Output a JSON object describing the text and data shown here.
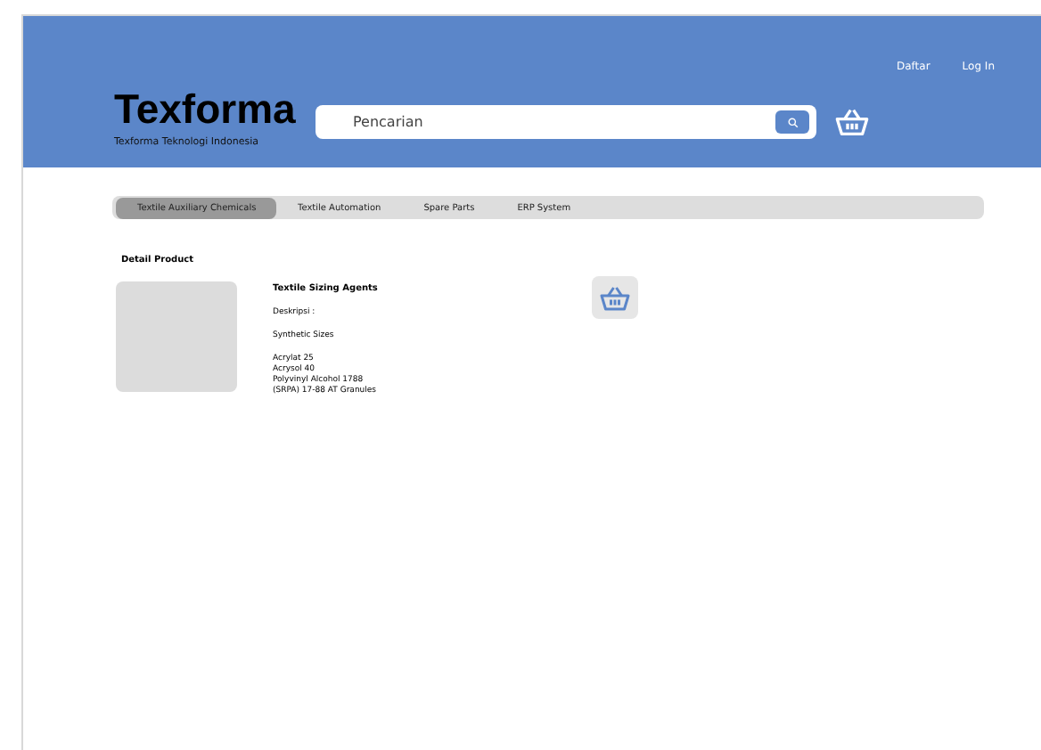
{
  "header": {
    "brand": "Texforma",
    "tagline": "Texforma Teknologi Indonesia",
    "nav_links": [
      "Daftar",
      "Log In"
    ],
    "search": {
      "placeholder": "Pencarian"
    }
  },
  "tabs": [
    {
      "label": "Textile Auxiliary Chemicals",
      "selected": true
    },
    {
      "label": "Textile Automation",
      "selected": false
    },
    {
      "label": "Spare Parts",
      "selected": false
    },
    {
      "label": "ERP System",
      "selected": false
    }
  ],
  "section_title": "Detail Product",
  "product": {
    "name": "Textile Sizing Agents",
    "description_label": "Deskripsi :",
    "category": "Synthetic Sizes",
    "items": [
      "Acrylat 25",
      "Acrysol 40",
      "Polyvinyl Alcohol 1788",
      "(SRPA) 17-88 AT Granules"
    ]
  }
}
